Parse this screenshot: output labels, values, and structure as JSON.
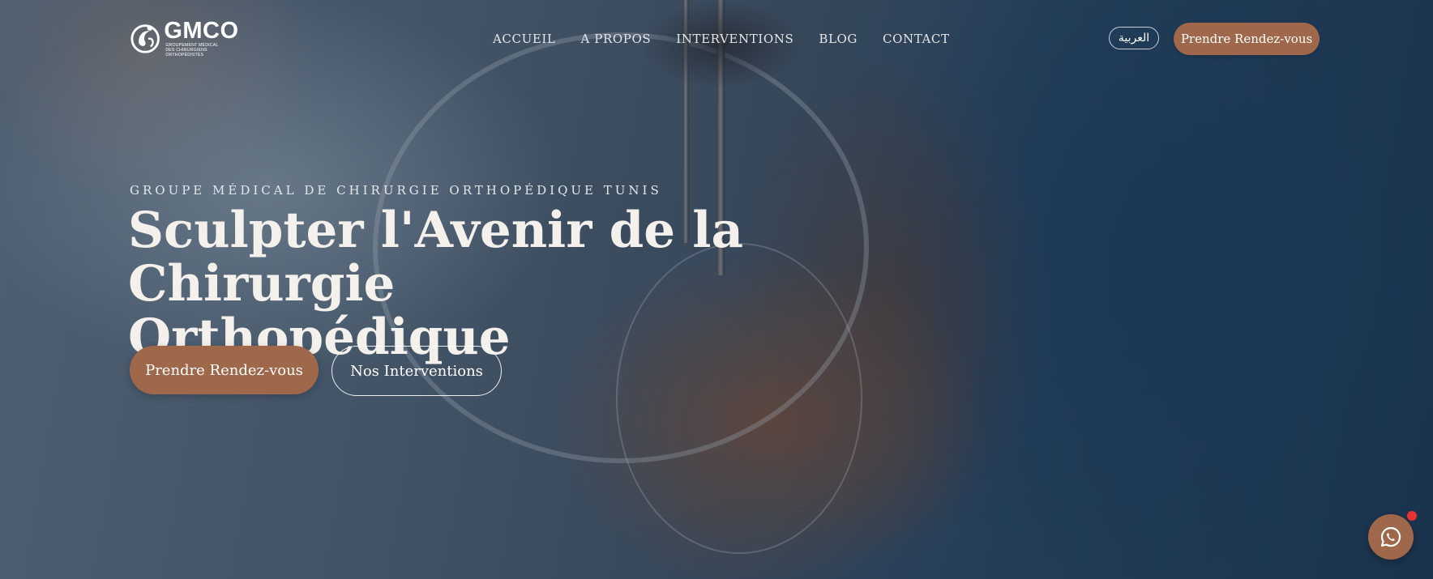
{
  "brand": {
    "name": "GMCO",
    "subtitle_line1": "GROUPEMENT MÉDICAL",
    "subtitle_line2": "DES CHIRURGIENS ORTHOPÉDISTES"
  },
  "nav": {
    "items": [
      {
        "label": "ACCUEIL"
      },
      {
        "label": "A PROPOS"
      },
      {
        "label": "INTERVENTIONS"
      },
      {
        "label": "BLOG"
      },
      {
        "label": "CONTACT"
      }
    ]
  },
  "header": {
    "language_label": "العربية",
    "cta_label": "Prendre Rendez-vous"
  },
  "hero": {
    "eyebrow": "GROUPE MÉDICAL DE CHIRURGIE ORTHOPÉDIQUE TUNIS",
    "title_line1": "Sculpter l'Avenir de la",
    "title_line2": "Chirurgie Orthopédique",
    "primary_button": "Prendre Rendez-vous",
    "secondary_button": "Nos Interventions"
  },
  "chat": {
    "icon": "whatsapp-icon"
  },
  "colors": {
    "accent": "#a0684a",
    "notification": "#e8332f",
    "text_light": "#f4f1ec"
  }
}
